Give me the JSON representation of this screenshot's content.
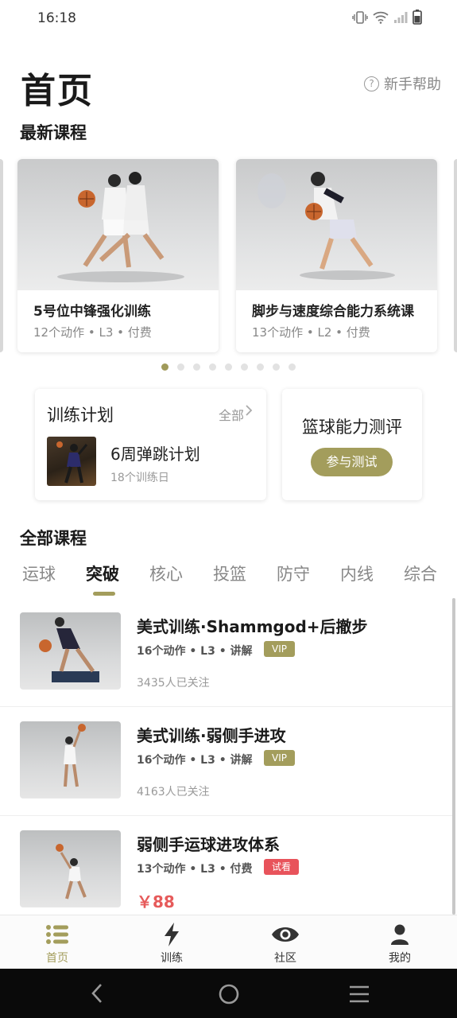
{
  "status_bar": {
    "time": "16:18"
  },
  "header": {
    "title": "首页",
    "help_label": "新手帮助"
  },
  "latest_courses": {
    "section_title": "最新课程",
    "cards": [
      {
        "title": "5号位中锋强化训练",
        "meta": "12个动作 • L3 • 付费"
      },
      {
        "title": "脚步与速度综合能力系统课",
        "meta": "13个动作 • L2 • 付费"
      }
    ],
    "dots": {
      "count": 9,
      "active_index": 0
    }
  },
  "training_plan": {
    "title": "训练计划",
    "all_label": "全部",
    "plan_name": "6周弹跳计划",
    "plan_days": "18个训练日"
  },
  "evaluation": {
    "title": "篮球能力测评",
    "button_label": "参与测试"
  },
  "all_courses": {
    "section_title": "全部课程",
    "tabs": [
      "运球",
      "突破",
      "核心",
      "投篮",
      "防守",
      "内线",
      "综合"
    ],
    "active_tab_index": 1,
    "items": [
      {
        "title": "美式训练·Shammgod+后撤步",
        "meta": "16个动作 • L3 • 讲解",
        "badge": "VIP",
        "footer": "3435人已关注"
      },
      {
        "title": "美式训练·弱侧手进攻",
        "meta": "16个动作 • L3 • 讲解",
        "badge": "VIP",
        "footer": "4163人已关注"
      },
      {
        "title": "弱侧手运球进攻体系",
        "meta": "13个动作 • L3 • 付费",
        "badge": "试看",
        "footer": "￥88"
      }
    ]
  },
  "bottom_nav": [
    {
      "label": "首页",
      "icon": "list-icon",
      "active": true
    },
    {
      "label": "训练",
      "icon": "lightning-icon",
      "active": false
    },
    {
      "label": "社区",
      "icon": "eye-icon",
      "active": false
    },
    {
      "label": "我的",
      "icon": "person-icon",
      "active": false
    }
  ],
  "colors": {
    "accent": "#a39d5c",
    "price": "#e65a5a",
    "trial_badge": "#e8535b"
  }
}
